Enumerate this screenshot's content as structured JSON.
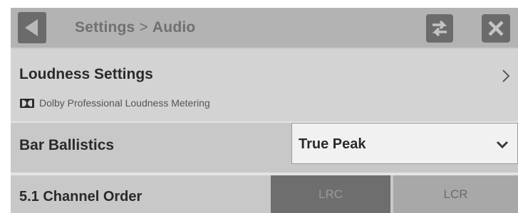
{
  "header": {
    "breadcrumb": {
      "parent": "Settings",
      "separator": ">",
      "current": "Audio"
    }
  },
  "loudness": {
    "title": "Loudness Settings",
    "subtitle": "Dolby Professional Loudness Metering"
  },
  "bar_ballistics": {
    "label": "Bar Ballistics",
    "selected": "True Peak"
  },
  "channel_order": {
    "label": "5.1 Channel Order",
    "options": [
      "LRC",
      "LCR"
    ],
    "selected": "LRC"
  },
  "colors": {
    "header_bg": "#b3b3b3",
    "button_bg": "#6b6b6b",
    "row_bg": "#c8c8c8",
    "selected_segment": "#6e6e6e",
    "unselected_segment": "#a8a8a8"
  },
  "icons": [
    "back-arrow-icon",
    "swap-icon",
    "close-icon",
    "chevron-right-icon",
    "dolby-logo-icon",
    "chevron-down-icon"
  ]
}
